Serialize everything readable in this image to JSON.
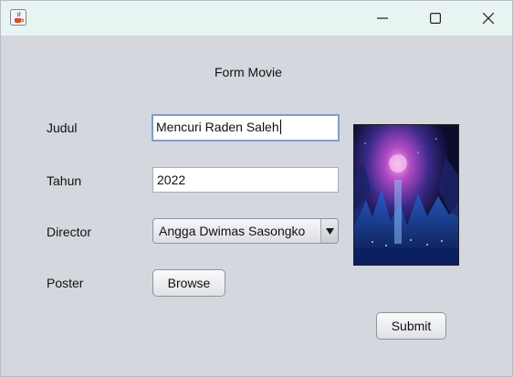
{
  "window": {
    "title": "",
    "controls": {
      "minimize": "minimize-icon",
      "maximize": "maximize-icon",
      "close": "close-icon"
    }
  },
  "form": {
    "heading": "Form Movie",
    "judul_label": "Judul",
    "judul_value": "Mencuri Raden Saleh",
    "tahun_label": "Tahun",
    "tahun_value": "2022",
    "director_label": "Director",
    "director_value": "Angga Dwimas Sasongko",
    "poster_label": "Poster",
    "browse_label": "Browse",
    "submit_label": "Submit"
  },
  "colors": {
    "window_bg": "#d5d7de",
    "titlebar_bg": "#e8f4f1",
    "focus_border": "#7f9fbf"
  }
}
